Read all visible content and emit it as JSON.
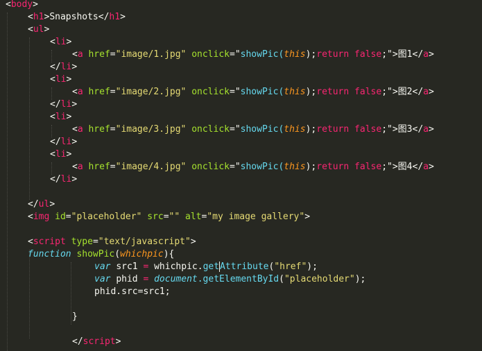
{
  "code": {
    "body_tag": "body",
    "h1_tag": "h1",
    "h1_text": "Snapshots",
    "ul_tag": "ul",
    "li_tag": "li",
    "a_tag": "a",
    "href_attr": "href",
    "onclick_attr": "onclick",
    "show_pic_call": "showPic(",
    "this_keyword": "this",
    "return_keyword": "return",
    "false_keyword": "false",
    "call_end": ");",
    "semicolon": ";",
    "links": [
      {
        "href": "\"image/1.jpg\"",
        "text": "图1"
      },
      {
        "href": "\"image/2.jpg\"",
        "text": "图2"
      },
      {
        "href": "\"image/3.jpg\"",
        "text": "图3"
      },
      {
        "href": "\"image/4.jpg\"",
        "text": "图4"
      }
    ],
    "img_tag": "img",
    "id_attr": "id",
    "id_value": "\"placeholder\"",
    "src_attr": "src",
    "src_value": "\"\"",
    "alt_attr": "alt",
    "alt_value": "\"my image gallery\"",
    "script_tag": "script",
    "type_attr": "type",
    "type_value": "\"text/javascript\"",
    "function_keyword": "function",
    "function_name": "showPic",
    "param_name": "whichpic",
    "var_keyword": "var",
    "var1_name": "src1",
    "var1_rhs_obj": "whichpic.",
    "get_attribute_a": "get",
    "get_attribute_b": "Attribute",
    "get_attribute_arg": "\"href\"",
    "var2_name": "phid",
    "document_obj": "document",
    "get_element_by_id": ".getElementById",
    "get_element_arg": "\"placeholder\"",
    "assign_statement": "phid.src=src1;",
    "close_brace": "}",
    "eq": " = ",
    "open_paren": "(",
    "close_paren": ")",
    "fn_open": "){"
  }
}
